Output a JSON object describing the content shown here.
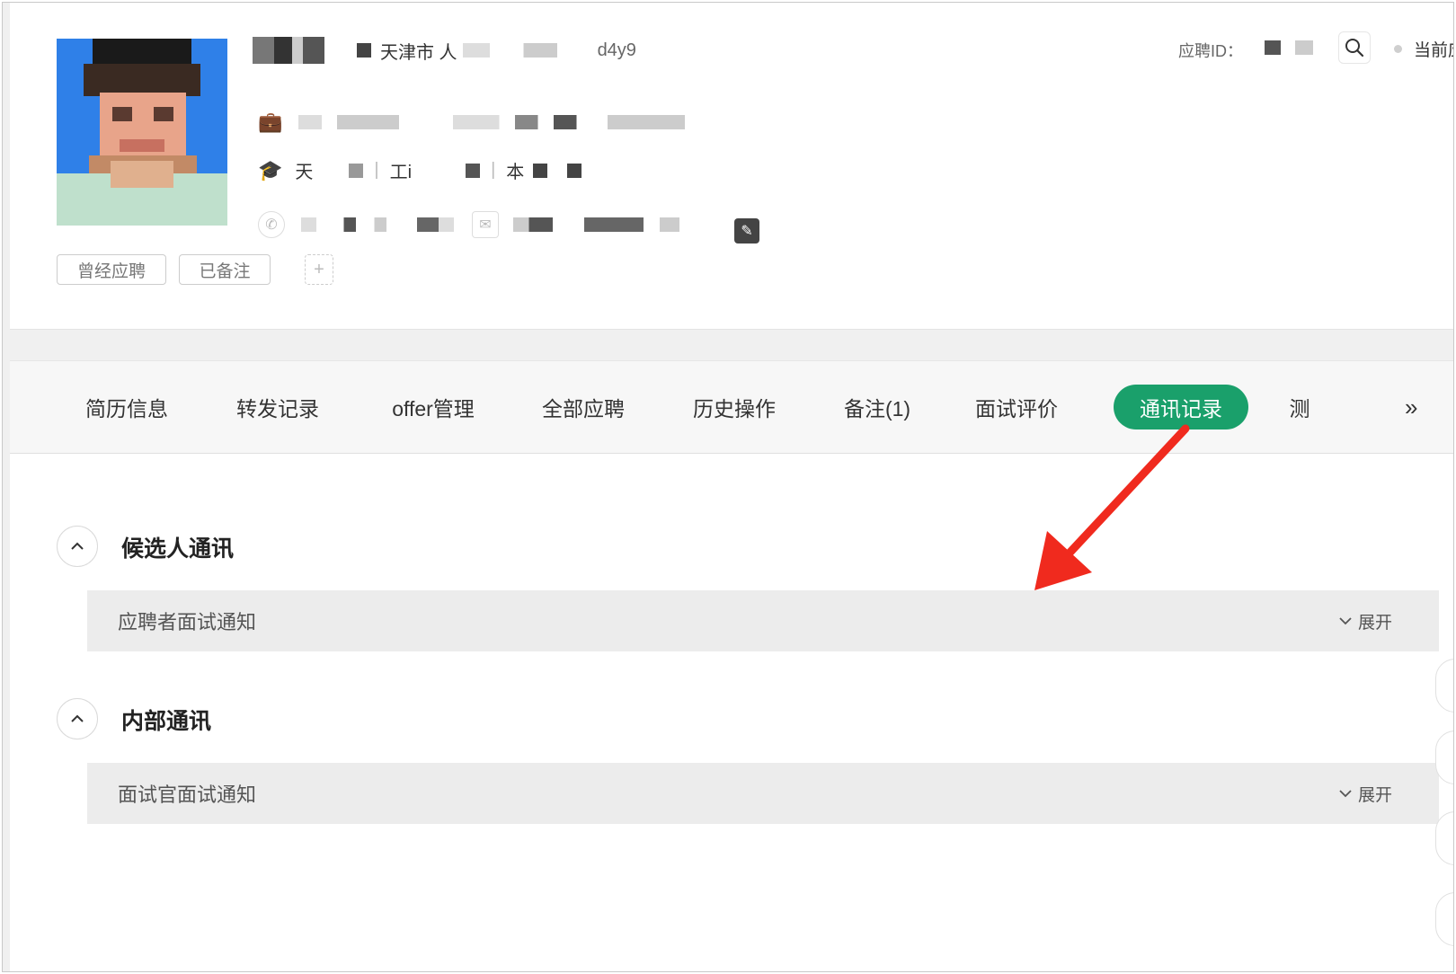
{
  "header": {
    "name_line_city": "天津市 人",
    "name_line_suffix": "d4y9",
    "education_school": "天",
    "education_major": "工i",
    "education_degree": "本",
    "app_id_label": "应聘ID：",
    "current_label": "当前应",
    "tags": [
      "曾经应聘",
      "已备注"
    ],
    "add_tag_symbol": "+"
  },
  "tabs": [
    {
      "label": "简历信息",
      "active": false
    },
    {
      "label": "转发记录",
      "active": false
    },
    {
      "label": "offer管理",
      "active": false
    },
    {
      "label": "全部应聘",
      "active": false
    },
    {
      "label": "历史操作",
      "active": false
    },
    {
      "label": "备注(1)",
      "active": false
    },
    {
      "label": "面试评价",
      "active": false
    },
    {
      "label": "通讯记录",
      "active": true
    },
    {
      "label": "测",
      "active": false
    }
  ],
  "tabs_more_symbol": "»",
  "sections": [
    {
      "title": "候选人通讯",
      "row_label": "应聘者面试通知",
      "expand_label": "展开"
    },
    {
      "title": "内部通讯",
      "row_label": "面试官面试通知",
      "expand_label": "展开"
    }
  ],
  "colors": {
    "accent": "#1aa06b",
    "arrow": "#f02a1e"
  }
}
